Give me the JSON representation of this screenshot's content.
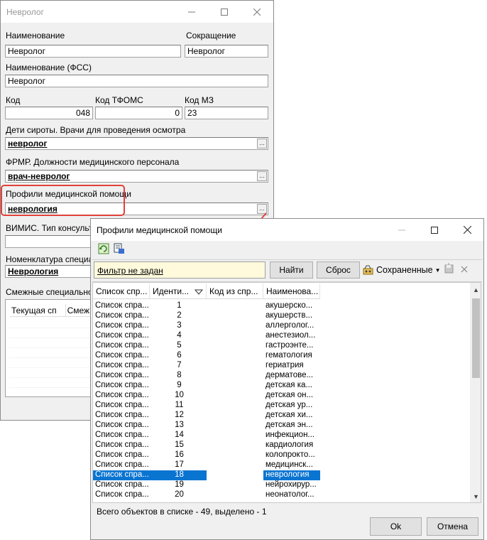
{
  "main_window": {
    "title": "Невролог",
    "naimenovanie_label": "Наименование",
    "naimenovanie_value": "Невролог",
    "sokrashchenie_label": "Сокращение",
    "sokrashchenie_value": "Невролог",
    "fss_label": "Наименование (ФСС)",
    "fss_value": "Невролог",
    "kod_label": "Код",
    "kod_value": "048",
    "kod_tfoms_label": "Код ТФОМС",
    "kod_tfoms_value": "0",
    "kod_mz_label": "Код МЗ",
    "kod_mz_value": "23",
    "deti_label": "Дети сироты. Врачи для проведения осмотра",
    "deti_value": "невролог",
    "frmr_label": "ФРМР. Должности медицинского персонала",
    "frmr_value": "врач-невролог",
    "profili_label": "Профили медицинской помощи",
    "profili_value": "неврология",
    "vimis_label": "ВИМИС. Тип консульта",
    "nomenklatura_label": "Номенклатура специал",
    "nomenklatura_value": "Неврология",
    "smezhnye_label": "Смежные специальност",
    "tbl_col1": "Текущая сп",
    "tbl_col2": "Смежн",
    "dots": "..."
  },
  "dialog": {
    "title": "Профили медицинской помощи",
    "filter_text": "Фильтр не задан",
    "find_button": "Найти",
    "reset_button": "Сброс",
    "saved_label": "Сохраненные",
    "columns": [
      "Список спр...",
      "Иденти...",
      "Код из спр...",
      "Наименова..."
    ],
    "rows": [
      {
        "list": "Список спра...",
        "id": "1",
        "name": "акушерско..."
      },
      {
        "list": "Список спра...",
        "id": "2",
        "name": "акушерств..."
      },
      {
        "list": "Список спра...",
        "id": "3",
        "name": "аллерголог..."
      },
      {
        "list": "Список спра...",
        "id": "4",
        "name": "анестезиол..."
      },
      {
        "list": "Список спра...",
        "id": "5",
        "name": "гастроэнте..."
      },
      {
        "list": "Список спра...",
        "id": "6",
        "name": "гематология"
      },
      {
        "list": "Список спра...",
        "id": "7",
        "name": "гериатрия"
      },
      {
        "list": "Список спра...",
        "id": "8",
        "name": "дерматове..."
      },
      {
        "list": "Список спра...",
        "id": "9",
        "name": "детская ка..."
      },
      {
        "list": "Список спра...",
        "id": "10",
        "name": "детская он..."
      },
      {
        "list": "Список спра...",
        "id": "11",
        "name": "детская ур..."
      },
      {
        "list": "Список спра...",
        "id": "12",
        "name": "детская хи..."
      },
      {
        "list": "Список спра...",
        "id": "13",
        "name": "детская эн..."
      },
      {
        "list": "Список спра...",
        "id": "14",
        "name": "инфекцион..."
      },
      {
        "list": "Список спра...",
        "id": "15",
        "name": "кардиология"
      },
      {
        "list": "Список спра...",
        "id": "16",
        "name": "колопрокто..."
      },
      {
        "list": "Список спра...",
        "id": "17",
        "name": "медицинск..."
      },
      {
        "list": "Список спра...",
        "id": "18",
        "name": "неврология",
        "selected": true
      },
      {
        "list": "Список спра...",
        "id": "19",
        "name": "нейрохирур..."
      },
      {
        "list": "Список спра...",
        "id": "20",
        "name": "неонатолог..."
      }
    ],
    "status": "Всего объектов в списке - 49, выделено - 1",
    "ok_button": "Ok",
    "cancel_button": "Отмена"
  },
  "icons": {
    "minimize": "minimize-icon",
    "maximize": "maximize-icon",
    "close": "close-icon",
    "refresh": "refresh-icon",
    "export": "export-icon",
    "saved": "saved-filters-icon",
    "save_filter": "save-filter-icon",
    "clear_filter": "clear-filter-icon",
    "sort_desc": "sort-desc-icon"
  },
  "colors": {
    "highlight": "#e0413a",
    "selection": "#0a74d1",
    "filter_bg": "#fffadc"
  }
}
